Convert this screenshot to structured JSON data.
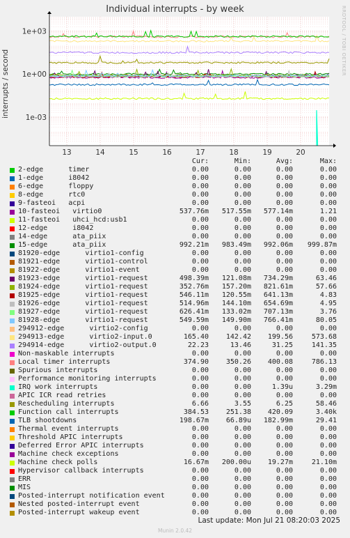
{
  "title": "Individual interrupts - by week",
  "watermark": "RRDTOOL / TOBI OETIKER",
  "footer": {
    "last_update": "Last update:  Mon Jul 21 08:20:03 2025",
    "version": "Munin 2.0.42"
  },
  "legend_header": {
    "cur": "Cur:",
    "min": "Min:",
    "avg": "Avg:",
    "max": "Max:"
  },
  "chart_data": {
    "type": "line",
    "title": "Individual interrupts - by week",
    "ylabel": "interrupts / second",
    "yscale": "log",
    "ylim": [
      1e-05,
      10000
    ],
    "y_ticks": [
      {
        "label": "1e+03",
        "value": 1000
      },
      {
        "label": "1e+00",
        "value": 1
      },
      {
        "label": "1e-03",
        "value": 0.001
      }
    ],
    "x_ticks": [
      "13",
      "14",
      "15",
      "16",
      "17",
      "18",
      "19",
      "20"
    ],
    "grid": true,
    "series": [
      {
        "name": "2-edge      timer",
        "color": "#00cc00",
        "cur": "0.00",
        "min": "0.00",
        "avg": "0.00",
        "max": "0.00",
        "level": 0
      },
      {
        "name": "1-edge      i8042",
        "color": "#0066b3",
        "cur": "0.00",
        "min": "0.00",
        "avg": "0.00",
        "max": "0.00",
        "level": 0
      },
      {
        "name": "6-edge      floppy",
        "color": "#ff8000",
        "cur": "0.00",
        "min": "0.00",
        "avg": "0.00",
        "max": "0.00",
        "level": 0
      },
      {
        "name": "8-edge      rtc0",
        "color": "#ffcc00",
        "cur": "0.00",
        "min": "0.00",
        "avg": "0.00",
        "max": "0.00",
        "level": 0
      },
      {
        "name": "9-fasteoi   acpi",
        "color": "#330099",
        "cur": "0.00",
        "min": "0.00",
        "avg": "0.00",
        "max": "0.00",
        "level": 0
      },
      {
        "name": "10-fasteoi   virtio0",
        "color": "#990099",
        "cur": "537.76m",
        "min": "517.55m",
        "avg": "577.14m",
        "max": "1.21",
        "level": 0.577
      },
      {
        "name": "11-fasteoi   uhci_hcd:usb1",
        "color": "#ccff00",
        "cur": "0.00",
        "min": "0.00",
        "avg": "0.00",
        "max": "0.00",
        "level": 0
      },
      {
        "name": "12-edge      i8042",
        "color": "#ff0000",
        "cur": "0.00",
        "min": "0.00",
        "avg": "0.00",
        "max": "0.00",
        "level": 0
      },
      {
        "name": "14-edge      ata_piix",
        "color": "#808080",
        "cur": "0.00",
        "min": "0.00",
        "avg": "0.00",
        "max": "0.00",
        "level": 0
      },
      {
        "name": "15-edge      ata_piix",
        "color": "#008f00",
        "cur": "992.21m",
        "min": "983.49m",
        "avg": "992.06m",
        "max": "999.87m",
        "level": 0.992
      },
      {
        "name": "81920-edge      virtio1-config",
        "color": "#00487d",
        "cur": "0.00",
        "min": "0.00",
        "avg": "0.00",
        "max": "0.00",
        "level": 0
      },
      {
        "name": "81921-edge      virtio1-control",
        "color": "#b35a00",
        "cur": "0.00",
        "min": "0.00",
        "avg": "0.00",
        "max": "0.00",
        "level": 0
      },
      {
        "name": "81922-edge      virtio1-event",
        "color": "#b38f00",
        "cur": "0.00",
        "min": "0.00",
        "avg": "0.00",
        "max": "0.00",
        "level": 0
      },
      {
        "name": "81923-edge      virtio1-request",
        "color": "#6b006b",
        "cur": "498.39m",
        "min": "121.08m",
        "avg": "734.29m",
        "max": "63.46",
        "level": 0.734
      },
      {
        "name": "81924-edge      virtio1-request",
        "color": "#8fb300",
        "cur": "352.76m",
        "min": "157.20m",
        "avg": "821.61m",
        "max": "57.66",
        "level": 0.822
      },
      {
        "name": "81925-edge      virtio1-request",
        "color": "#b30000",
        "cur": "546.11m",
        "min": "120.55m",
        "avg": "641.13m",
        "max": "4.83",
        "level": 0.641
      },
      {
        "name": "81926-edge      virtio1-request",
        "color": "#bebebe",
        "cur": "514.96m",
        "min": "144.10m",
        "avg": "654.69m",
        "max": "4.95",
        "level": 0.655
      },
      {
        "name": "81927-edge      virtio1-request",
        "color": "#80ff80",
        "cur": "626.41m",
        "min": "133.02m",
        "avg": "707.13m",
        "max": "3.76",
        "level": 0.707
      },
      {
        "name": "81928-edge      virtio1-request",
        "color": "#80c9ff",
        "cur": "549.59m",
        "min": "149.90m",
        "avg": "766.41m",
        "max": "80.05",
        "level": 0.766
      },
      {
        "name": "294912-edge      virtio2-config",
        "color": "#ffc080",
        "cur": "0.00",
        "min": "0.00",
        "avg": "0.00",
        "max": "0.00",
        "level": 0
      },
      {
        "name": "294913-edge      virtio2-input.0",
        "color": "#ffe680",
        "cur": "165.40",
        "min": "142.42",
        "avg": "199.56",
        "max": "573.68",
        "level": 199.56
      },
      {
        "name": "294914-edge      virtio2-output.0",
        "color": "#aa80ff",
        "cur": "22.23",
        "min": "13.46",
        "avg": "31.25",
        "max": "141.35",
        "level": 31.25
      },
      {
        "name": "Non-maskable interrupts",
        "color": "#ee00cc",
        "cur": "0.00",
        "min": "0.00",
        "avg": "0.00",
        "max": "0.00",
        "level": 0
      },
      {
        "name": "Local timer interrupts",
        "color": "#ff8080",
        "cur": "374.90",
        "min": "350.26",
        "avg": "400.08",
        "max": "786.13",
        "level": 400.08
      },
      {
        "name": "Spurious interrupts",
        "color": "#666600",
        "cur": "0.00",
        "min": "0.00",
        "avg": "0.00",
        "max": "0.00",
        "level": 0
      },
      {
        "name": "Performance monitoring interrupts",
        "color": "#ffbfff",
        "cur": "0.00",
        "min": "0.00",
        "avg": "0.00",
        "max": "0.00",
        "level": 0
      },
      {
        "name": "IRQ work interrupts",
        "color": "#00ffcc",
        "cur": "0.00",
        "min": "0.00",
        "avg": "1.39u",
        "max": "3.29m",
        "level": 0
      },
      {
        "name": "APIC ICR read retries",
        "color": "#cc6699",
        "cur": "0.00",
        "min": "0.00",
        "avg": "0.00",
        "max": "0.00",
        "level": 0
      },
      {
        "name": "Rescheduling interrupts",
        "color": "#999900",
        "cur": "6.66",
        "min": "3.55",
        "avg": "6.25",
        "max": "58.46",
        "level": 6.25
      },
      {
        "name": "Function call interrupts",
        "color": "#00cc00",
        "cur": "384.53",
        "min": "251.38",
        "avg": "420.09",
        "max": "3.40k",
        "level": 420.09
      },
      {
        "name": "TLB shootdowns",
        "color": "#0066b3",
        "cur": "198.67m",
        "min": "66.89u",
        "avg": "182.99m",
        "max": "29.41",
        "level": 0.183
      },
      {
        "name": "Thermal event interrupts",
        "color": "#ff8000",
        "cur": "0.00",
        "min": "0.00",
        "avg": "0.00",
        "max": "0.00",
        "level": 0
      },
      {
        "name": "Threshold APIC interrupts",
        "color": "#ffcc00",
        "cur": "0.00",
        "min": "0.00",
        "avg": "0.00",
        "max": "0.00",
        "level": 0
      },
      {
        "name": "Deferred Error APIC interrupts",
        "color": "#330099",
        "cur": "0.00",
        "min": "0.00",
        "avg": "0.00",
        "max": "0.00",
        "level": 0
      },
      {
        "name": "Machine check exceptions",
        "color": "#990099",
        "cur": "0.00",
        "min": "0.00",
        "avg": "0.00",
        "max": "0.00",
        "level": 0
      },
      {
        "name": "Machine check polls",
        "color": "#ccff00",
        "cur": "16.67m",
        "min": "200.00u",
        "avg": "19.27m",
        "max": "21.10m",
        "level": 0.0193
      },
      {
        "name": "Hypervisor callback interrupts",
        "color": "#ff0000",
        "cur": "0.00",
        "min": "0.00",
        "avg": "0.00",
        "max": "0.00",
        "level": 0
      },
      {
        "name": "ERR",
        "color": "#808080",
        "cur": "0.00",
        "min": "0.00",
        "avg": "0.00",
        "max": "0.00",
        "level": 0
      },
      {
        "name": "MIS",
        "color": "#008f00",
        "cur": "0.00",
        "min": "0.00",
        "avg": "0.00",
        "max": "0.00",
        "level": 0
      },
      {
        "name": "Posted-interrupt notification event",
        "color": "#00487d",
        "cur": "0.00",
        "min": "0.00",
        "avg": "0.00",
        "max": "0.00",
        "level": 0
      },
      {
        "name": "Nested posted-interrupt event",
        "color": "#b35a00",
        "cur": "0.00",
        "min": "0.00",
        "avg": "0.00",
        "max": "0.00",
        "level": 0
      },
      {
        "name": "Posted-interrupt wakeup event",
        "color": "#b38f00",
        "cur": "0.00",
        "min": "0.00",
        "avg": "0.00",
        "max": "0.00",
        "level": 0
      }
    ]
  }
}
